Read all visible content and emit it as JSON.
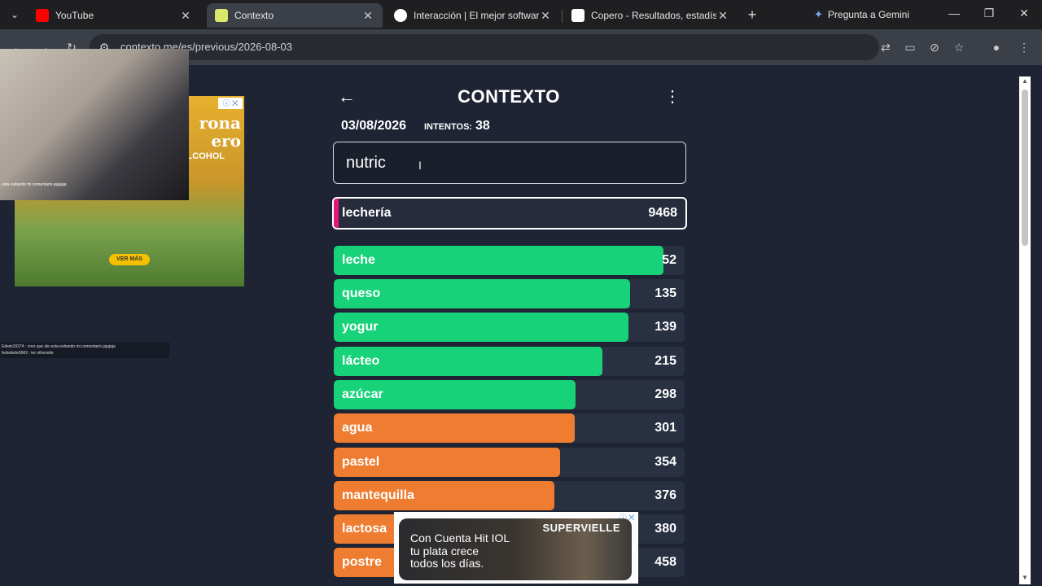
{
  "browser": {
    "tabs": [
      {
        "title": "YouTube",
        "icon": "youtube-icon",
        "color": "#ff0000"
      },
      {
        "title": "Contexto",
        "icon": "contexto-icon",
        "color": "#d9e86a",
        "active": true
      },
      {
        "title": "Interacción | El mejor software",
        "icon": "interaccion-icon",
        "color": "#ffffff"
      },
      {
        "title": "Copero - Resultados, estadístic",
        "icon": "copero-icon",
        "color": "#ffffff"
      }
    ],
    "gemini_label": "Pregunta a Gemini",
    "url": "contexto.me/es/previous/2026-08-03"
  },
  "ads": {
    "left": {
      "brand": "rona\nero",
      "alcohol": "LCOHOL",
      "cta": "VER MÁS",
      "badge": "ⓘ ⨉"
    },
    "bottom": {
      "line1": "Con Cuenta Hit IOL",
      "line2": "tu plata crece",
      "line3": "todos los días.",
      "brand": "SUPERVIELLE",
      "badge": "ⓘ ⨉"
    }
  },
  "webcam": {
    "caption": "esta evitando mi comentario jajajaja"
  },
  "chat": {
    "line1": "Edwin19374 : creo que sle esta evitando mi comentario jajajaja",
    "line2": "fededede6969 : ter otherside"
  },
  "game": {
    "title": "CONTEXTO",
    "date": "03/08/2026",
    "tries_label": "INTENTOS:",
    "tries": "38",
    "input_value": "nutric",
    "last_guess": {
      "word": "lechería",
      "rank": "9468"
    },
    "guesses": [
      {
        "word": "leche",
        "rank": "52",
        "fill": 0.94,
        "color": "#18d27a"
      },
      {
        "word": "queso",
        "rank": "135",
        "fill": 0.845,
        "color": "#18d27a"
      },
      {
        "word": "yogur",
        "rank": "139",
        "fill": 0.84,
        "color": "#18d27a"
      },
      {
        "word": "lácteo",
        "rank": "215",
        "fill": 0.765,
        "color": "#18d27a"
      },
      {
        "word": "azúcar",
        "rank": "298",
        "fill": 0.69,
        "color": "#18d27a"
      },
      {
        "word": "agua",
        "rank": "301",
        "fill": 0.687,
        "color": "#ef7d31"
      },
      {
        "word": "pastel",
        "rank": "354",
        "fill": 0.645,
        "color": "#ef7d31"
      },
      {
        "word": "mantequilla",
        "rank": "376",
        "fill": 0.628,
        "color": "#ef7d31"
      },
      {
        "word": "lactosa",
        "rank": "380",
        "fill": 0.62,
        "color": "#ef7d31"
      },
      {
        "word": "postre",
        "rank": "458",
        "fill": 0.58,
        "color": "#ef7d31"
      }
    ]
  }
}
